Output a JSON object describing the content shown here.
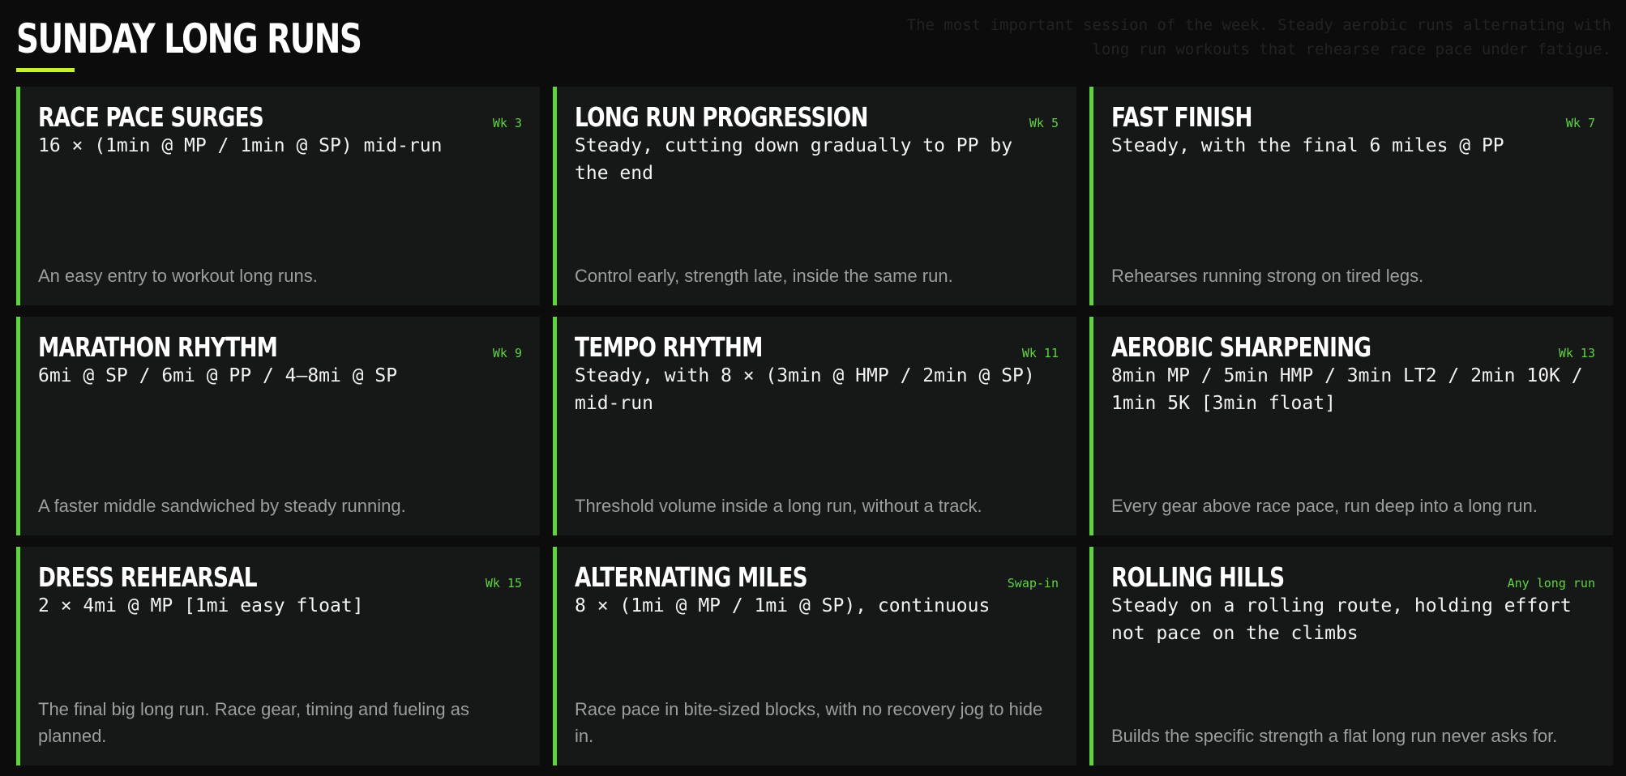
{
  "header": {
    "title": "SUNDAY LONG RUNS",
    "intro": "The most important session of the week. Steady aerobic runs alternating with long run workouts that rehearse race pace under fatigue."
  },
  "colors": {
    "background": "#0b0c0b",
    "card": "#151816",
    "accent_green": "#5fd43f",
    "underline": "#c6ef3a",
    "muted_text": "#9c9e9c"
  },
  "cards": [
    {
      "title": "RACE PACE SURGES",
      "week": "Wk 3",
      "workout": "16 × (1min @ MP / 1min @ SP) mid-run",
      "description": "An easy entry to workout long runs."
    },
    {
      "title": "LONG RUN PROGRESSION",
      "week": "Wk 5",
      "workout": "Steady, cutting down gradually to PP by the end",
      "description": "Control early, strength late, inside the same run."
    },
    {
      "title": "FAST FINISH",
      "week": "Wk 7",
      "workout": "Steady, with the final 6 miles @ PP",
      "description": "Rehearses running strong on tired legs."
    },
    {
      "title": "MARATHON RHYTHM",
      "week": "Wk 9",
      "workout": "6mi @ SP / 6mi @ PP / 4–8mi @ SP",
      "description": "A faster middle sandwiched by steady running."
    },
    {
      "title": "TEMPO RHYTHM",
      "week": "Wk 11",
      "workout": "Steady, with 8 × (3min @ HMP / 2min @ SP) mid-run",
      "description": "Threshold volume inside a long run, without a track."
    },
    {
      "title": "AEROBIC SHARPENING",
      "week": "Wk 13",
      "workout": "8min MP / 5min HMP / 3min LT2 / 2min 10K / 1min 5K [3min float]",
      "description": "Every gear above race pace, run deep into a long run."
    },
    {
      "title": "DRESS REHEARSAL",
      "week": "Wk 15",
      "workout": "2 × 4mi @ MP [1mi easy float]",
      "description": "The final big long run. Race gear, timing and fueling as planned."
    },
    {
      "title": "ALTERNATING MILES",
      "week": "Swap-in",
      "workout": "8 × (1mi @ MP / 1mi @ SP), continuous",
      "description": "Race pace in bite-sized blocks, with no recovery jog to hide in."
    },
    {
      "title": "ROLLING HILLS",
      "week": "Any long run",
      "workout": "Steady on a rolling route, holding effort not pace on the climbs",
      "description": "Builds the specific strength a flat long run never asks for."
    }
  ]
}
